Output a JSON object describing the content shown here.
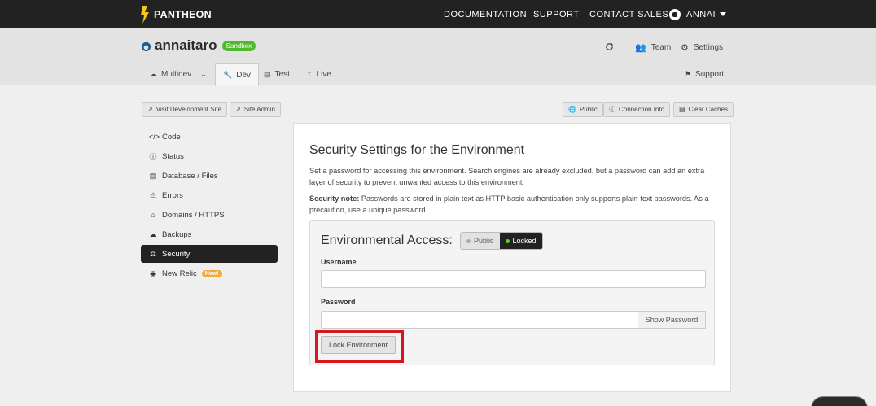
{
  "topbar": {
    "logo_text": "PANTHEON",
    "nav": [
      "DOCUMENTATION",
      "SUPPORT",
      "CONTACT SALES"
    ],
    "user": "ANNAI"
  },
  "header": {
    "site_name": "annaitaro",
    "badge": "Sandbox",
    "actions": {
      "team": "Team",
      "settings": "Settings",
      "support": "Support"
    },
    "tabs": {
      "multidev": "Multidev",
      "dev": "Dev",
      "test": "Test",
      "live": "Live"
    }
  },
  "toolbar": {
    "visit_dev": "Visit Development Site",
    "site_admin": "Site Admin",
    "public": "Public",
    "connection_info": "Connection Info",
    "clear_caches": "Clear Caches"
  },
  "sidebar": {
    "items": [
      {
        "label": "Code",
        "icon": "code-icon"
      },
      {
        "label": "Status",
        "icon": "info-icon"
      },
      {
        "label": "Database / Files",
        "icon": "database-icon"
      },
      {
        "label": "Errors",
        "icon": "warning-icon"
      },
      {
        "label": "Domains / HTTPS",
        "icon": "home-icon"
      },
      {
        "label": "Backups",
        "icon": "cloud-icon"
      },
      {
        "label": "Security",
        "icon": "security-icon",
        "active": true
      },
      {
        "label": "New Relic",
        "icon": "eye-icon",
        "badge": "New!"
      }
    ]
  },
  "main": {
    "title": "Security Settings for the Environment",
    "description": "Set a password for accessing this environment. Search engines are already excluded, but a password can add an extra layer of security to prevent unwanted access to this environment.",
    "note_label": "Security note:",
    "note_text": " Passwords are stored in plain text as HTTP basic authentication only supports plain-text passwords. As a precaution, use a unique password.",
    "access_title": "Environmental Access:",
    "toggle_public": "Public",
    "toggle_locked": "Locked",
    "username_label": "Username",
    "username_value": "",
    "password_label": "Password",
    "password_value": "",
    "show_password": "Show Password",
    "lock_button": "Lock Environment"
  },
  "colors": {
    "topbar": "#222222",
    "sandbox_badge": "#4fba2d",
    "new_badge": "#f0a93b",
    "highlight": "#d6171c",
    "locked_dot": "#5bd12f"
  }
}
